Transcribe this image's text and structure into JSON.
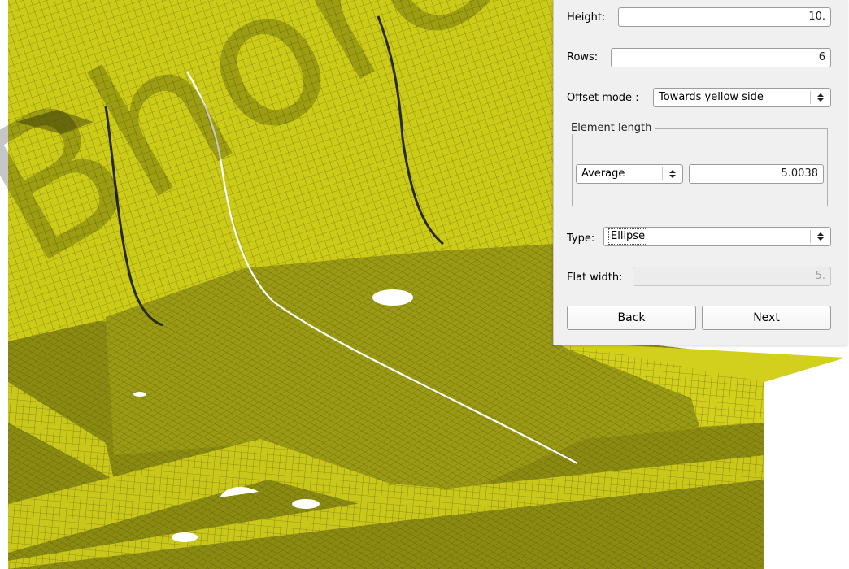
{
  "form": {
    "height": {
      "label": "Height:",
      "value": "10."
    },
    "rows": {
      "label": "Rows:",
      "value": "6"
    },
    "offset_mode": {
      "label": "Offset mode :",
      "value": "Towards yellow side"
    },
    "element_length": {
      "title": "Element length",
      "mode": "Average",
      "value": "5.0038"
    },
    "type": {
      "label": "Type:",
      "value": "Ellipse"
    },
    "flat_width": {
      "label": "Flat width:",
      "value": "5."
    }
  },
  "buttons": {
    "back": "Back",
    "next": "Next"
  },
  "watermark": "Bhore On",
  "colors": {
    "mesh_top": "#d4d21c",
    "mesh_floor": "#8a8a12",
    "grid": "#3a3a08",
    "panel_bg": "#f0f0f0"
  }
}
